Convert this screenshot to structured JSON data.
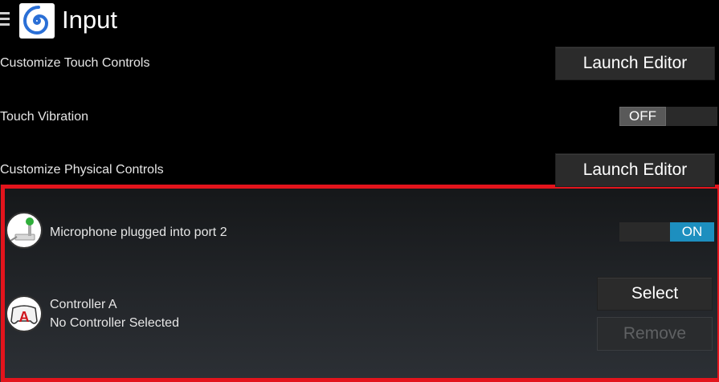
{
  "header": {
    "title": "Input",
    "menu_icon": "hamburger-menu-icon",
    "app_icon": "spiral-app-icon"
  },
  "settings": {
    "touch_controls": {
      "label": "Customize Touch Controls",
      "button": "Launch Editor"
    },
    "touch_vibration": {
      "label": "Touch Vibration",
      "toggle": "OFF",
      "state": false
    },
    "physical_controls": {
      "label": "Customize Physical Controls",
      "button": "Launch Editor"
    }
  },
  "devices": {
    "microphone": {
      "label": "Microphone plugged into port 2",
      "toggle": "ON",
      "state": true,
      "icon": "microphone-icon"
    },
    "controller": {
      "title": "Controller A",
      "subtitle": "No Controller Selected",
      "select_button": "Select",
      "remove_button": "Remove",
      "icon": "gamepad-icon"
    }
  },
  "colors": {
    "accent": "#1d8fbf",
    "highlight_frame": "#e3141c",
    "app_icon_blue": "#2a6fd6"
  }
}
